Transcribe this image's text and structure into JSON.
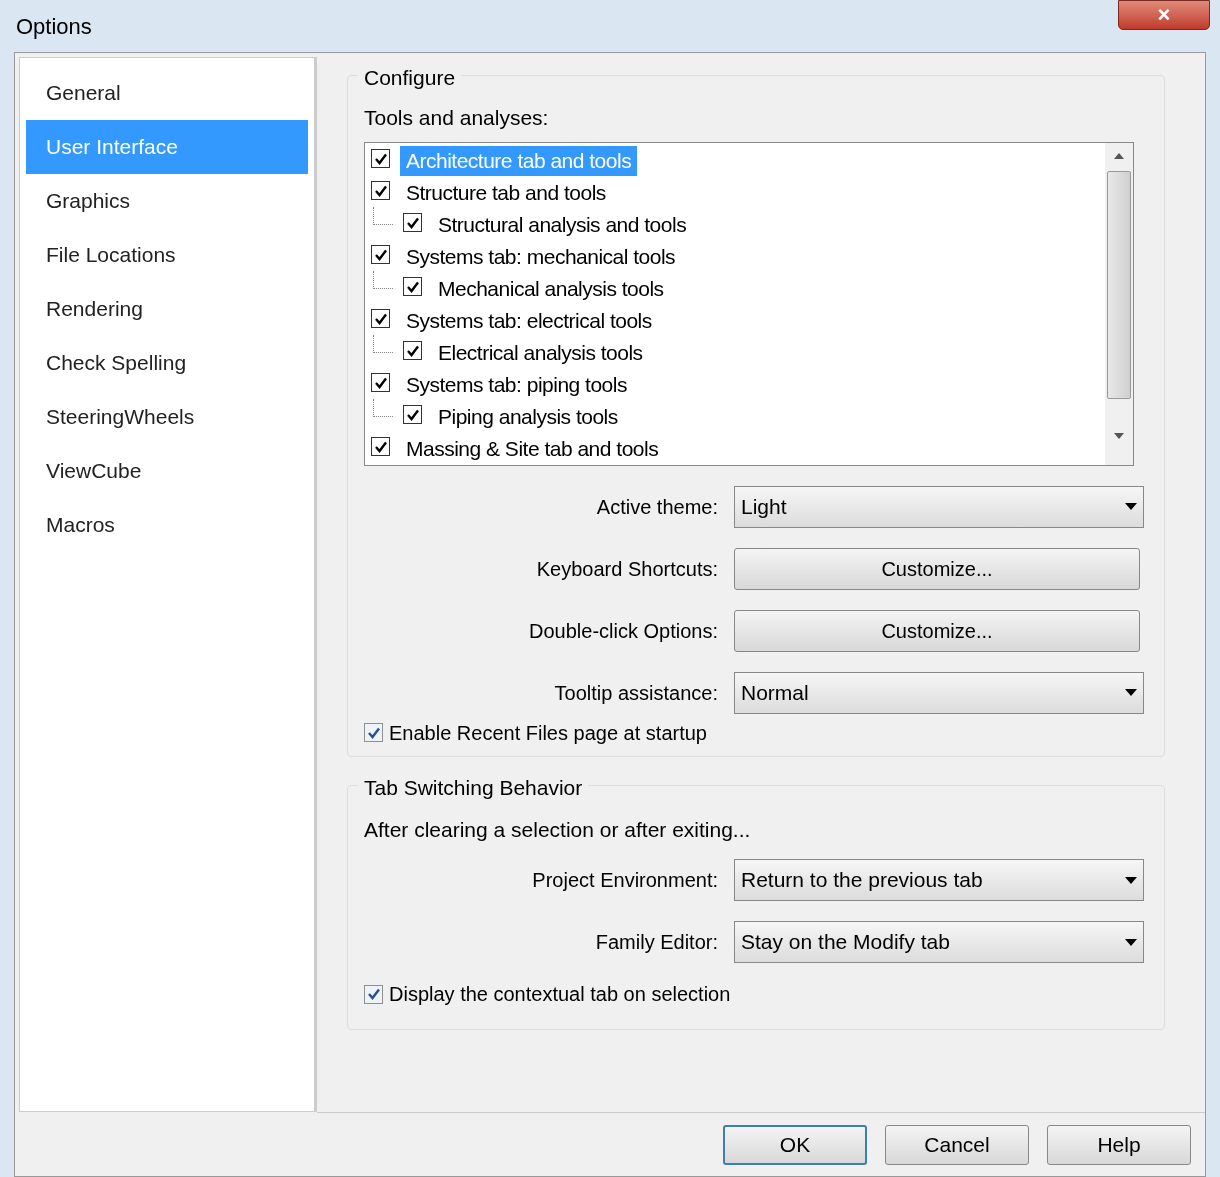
{
  "window": {
    "title": "Options",
    "close": "×"
  },
  "sidebar": {
    "items": [
      {
        "label": "General",
        "selected": false
      },
      {
        "label": "User Interface",
        "selected": true
      },
      {
        "label": "Graphics",
        "selected": false
      },
      {
        "label": "File Locations",
        "selected": false
      },
      {
        "label": "Rendering",
        "selected": false
      },
      {
        "label": "Check Spelling",
        "selected": false
      },
      {
        "label": "SteeringWheels",
        "selected": false
      },
      {
        "label": "ViewCube",
        "selected": false
      },
      {
        "label": "Macros",
        "selected": false
      }
    ]
  },
  "configure": {
    "title": "Configure",
    "list_label": "Tools and analyses:",
    "tools": [
      {
        "label": "Architecture tab and tools",
        "checked": true,
        "selected": true
      },
      {
        "label": "Structure tab and tools",
        "checked": true,
        "selected": false,
        "children": [
          {
            "label": "Structural analysis and tools",
            "checked": true,
            "selected": false
          }
        ]
      },
      {
        "label": "Systems tab: mechanical tools",
        "checked": true,
        "selected": false,
        "children": [
          {
            "label": "Mechanical analysis tools",
            "checked": true,
            "selected": false
          }
        ]
      },
      {
        "label": "Systems tab: electrical tools",
        "checked": true,
        "selected": false,
        "children": [
          {
            "label": "Electrical analysis tools",
            "checked": true,
            "selected": false
          }
        ]
      },
      {
        "label": "Systems tab: piping tools",
        "checked": true,
        "selected": false,
        "children": [
          {
            "label": "Piping analysis tools",
            "checked": true,
            "selected": false
          }
        ]
      },
      {
        "label": "Massing & Site tab and tools",
        "checked": true,
        "selected": false
      }
    ],
    "settings": [
      {
        "kind": "dropdown",
        "label": "Active theme:",
        "value": "Light"
      },
      {
        "kind": "button",
        "label": "Keyboard Shortcuts:",
        "value": "Customize..."
      },
      {
        "kind": "button",
        "label": "Double-click Options:",
        "value": "Customize..."
      },
      {
        "kind": "dropdown",
        "label": "Tooltip assistance:",
        "value": "Normal"
      }
    ],
    "recent_files": {
      "label": "Enable Recent Files page at startup",
      "checked": true
    }
  },
  "tab_switching": {
    "title": "Tab Switching Behavior",
    "description": "After clearing a selection or after exiting...",
    "settings": [
      {
        "kind": "dropdown",
        "label": "Project Environment:",
        "value": "Return to the previous tab"
      },
      {
        "kind": "dropdown",
        "label": "Family Editor:",
        "value": "Stay on the Modify tab"
      }
    ],
    "contextual": {
      "label": "Display the contextual tab on selection",
      "checked": true
    }
  },
  "buttons": [
    "OK",
    "Cancel",
    "Help"
  ]
}
